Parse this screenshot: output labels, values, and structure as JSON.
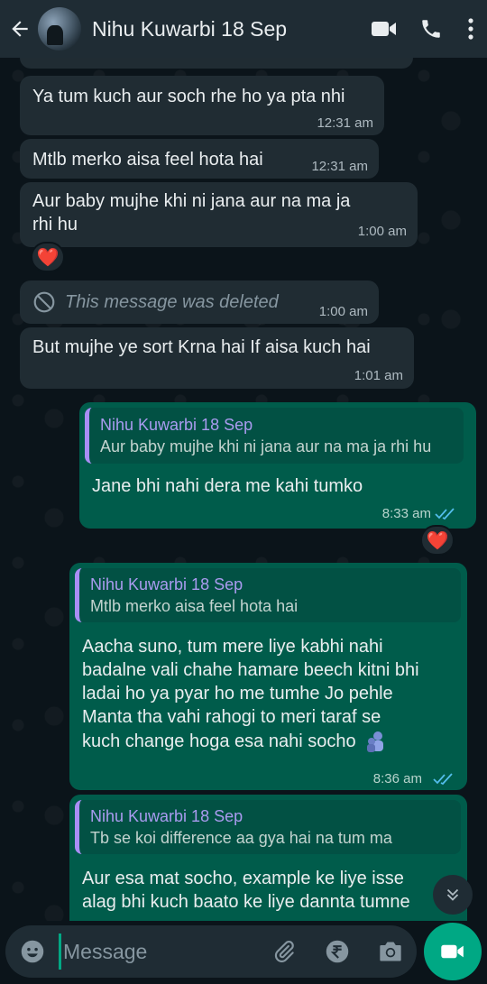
{
  "header": {
    "contact_name": "Nihu Kuwarbi 18 Sep"
  },
  "messages": [
    {
      "type": "in",
      "text": "Ya tum kuch aur soch rhe ho ya pta nhi",
      "time": "12:31 am"
    },
    {
      "type": "in",
      "text": "Mtlb merko aisa feel hota hai",
      "time": "12:31 am"
    },
    {
      "type": "in",
      "text_line1": "Aur baby mujhe khi ni jana aur na ma ja",
      "text_line2": "rhi hu",
      "time": "1:00 am"
    },
    {
      "type": "in-deleted",
      "text": "This message was deleted",
      "time": "1:00 am"
    },
    {
      "type": "in",
      "text": "But mujhe ye sort Krna hai If aisa kuch hai",
      "time": "1:01 am"
    },
    {
      "type": "out",
      "quote_name": "Nihu Kuwarbi 18 Sep",
      "quote_text": "Aur baby mujhe khi ni jana aur na ma ja rhi hu",
      "text": "Jane bhi nahi dera me kahi tumko",
      "time": "8:33 am"
    },
    {
      "type": "out",
      "quote_name": "Nihu Kuwarbi 18 Sep",
      "quote_text": "Mtlb merko aisa feel hota hai",
      "lines": [
        "Aacha suno, tum mere liye kabhi nahi",
        "badalne vali chahe hamare beech kitni bhi",
        "ladai ho ya pyar ho me tumhe Jo pehle",
        "Manta tha vahi rahogi to meri taraf se",
        "kuch change hoga esa nahi socho"
      ],
      "time": "8:36 am"
    },
    {
      "type": "out",
      "quote_name": "Nihu Kuwarbi 18 Sep",
      "quote_text": "Tb se koi difference aa gya hai na tum ma",
      "lines": [
        "Aur esa mat socho, example ke liye isse",
        "alag bhi kuch baato ke liye dannta tumne"
      ]
    }
  ],
  "reactions": {
    "heart": "❤️"
  },
  "input": {
    "placeholder": "Message"
  },
  "colors": {
    "header_bg": "#1f2c34",
    "incoming_bg": "#202c33",
    "outgoing_bg": "#005c4b",
    "accent": "#00a884",
    "read_ticks": "#53bdeb"
  },
  "icons": [
    "back-arrow-icon",
    "video-call-icon",
    "phone-icon",
    "more-options-icon",
    "emoji-icon",
    "attach-icon",
    "rupee-payment-icon",
    "camera-icon",
    "video-record-icon",
    "chevron-down-icon",
    "blocked-icon",
    "double-check-icon"
  ]
}
